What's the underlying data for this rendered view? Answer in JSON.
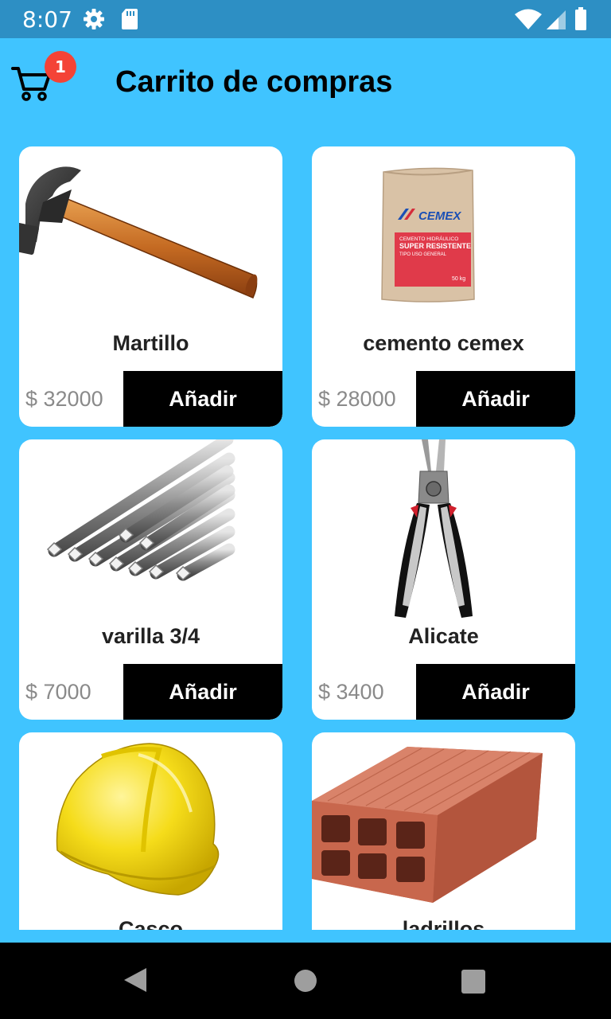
{
  "status_bar": {
    "time": "8:07",
    "icons": [
      "gear-icon",
      "sd-card-icon",
      "wifi-icon",
      "signal-icon",
      "battery-icon"
    ]
  },
  "app_bar": {
    "title": "Carrito de compras",
    "cart_icon": "shopping-cart-icon",
    "cart_count": "1"
  },
  "products": [
    {
      "name": "Martillo",
      "price": "$ 32000",
      "button": "Añadir",
      "image": "hammer"
    },
    {
      "name": "cemento cemex",
      "price": "$ 28000",
      "button": "Añadir",
      "image": "cement-bag",
      "image_text": [
        "CEMEX",
        "CEMENTO HIDRÁULICO",
        "SUPER RESISTENTE",
        "TIPO USO GENERAL",
        "50 kg"
      ]
    },
    {
      "name": "varilla 3/4",
      "price": "$ 7000",
      "button": "Añadir",
      "image": "steel-rebar"
    },
    {
      "name": "Alicate",
      "price": "$ 3400",
      "button": "Añadir",
      "image": "pliers"
    },
    {
      "name": "Casco",
      "image": "hard-hat"
    },
    {
      "name": "ladrillos",
      "image": "brick"
    }
  ],
  "nav_bar": {
    "buttons": [
      "back-icon",
      "home-icon",
      "recents-icon"
    ]
  },
  "colors": {
    "background": "#40c4ff",
    "status_bar": "#2d8fc4",
    "button": "#000000",
    "badge": "#f44336",
    "card": "#ffffff"
  }
}
